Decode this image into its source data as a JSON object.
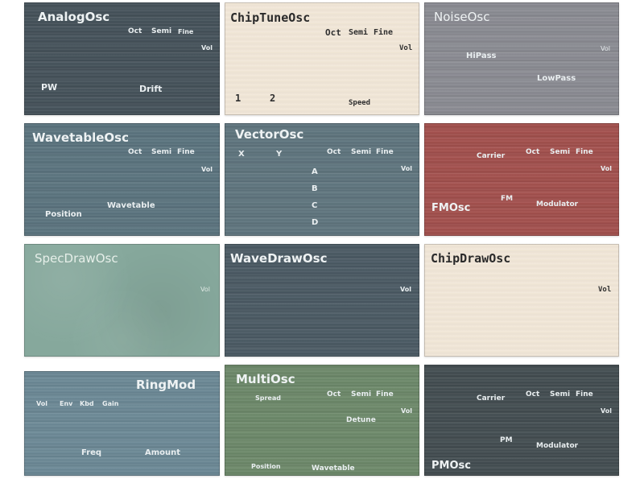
{
  "colors": {
    "analog_bg": "#46535b",
    "chiptune_bg": "#f1e6d7",
    "noise_bg": "#8c8d94",
    "wavetable_bg": "#5c7580",
    "vector_bg": "#60767f",
    "fm_bg": "#a4514e",
    "specdraw_bg": "#86a89c",
    "wavedraw_bg": "#4c5b65",
    "chipdraw_bg": "#f1e6d7",
    "ringmod_bg": "#6d8a97",
    "multi_bg": "#6e8a6b",
    "pm_bg": "#444e52"
  },
  "panels": {
    "analog": {
      "title": "AnalogOsc",
      "oct": "Oct",
      "semi": "Semi",
      "fine": "Fine",
      "vol": "Vol",
      "pw": "PW",
      "drift": "Drift"
    },
    "chiptune": {
      "title": "ChipTuneOsc",
      "oct": "Oct",
      "semi": "Semi",
      "fine": "Fine",
      "vol": "Vol",
      "one": "1",
      "two": "2",
      "speed": "Speed"
    },
    "noise": {
      "title": "NoiseOsc",
      "vol": "Vol",
      "hipass": "HiPass",
      "lowpass": "LowPass"
    },
    "wavetable": {
      "title": "WavetableOsc",
      "oct": "Oct",
      "semi": "Semi",
      "fine": "Fine",
      "vol": "Vol",
      "position": "Position",
      "wavetable": "Wavetable"
    },
    "vector": {
      "title": "VectorOsc",
      "x": "X",
      "y": "Y",
      "oct": "Oct",
      "semi": "Semi",
      "fine": "Fine",
      "vol": "Vol",
      "a": "A",
      "b": "B",
      "c": "C",
      "d": "D"
    },
    "fm": {
      "title": "FMOsc",
      "carrier": "Carrier",
      "oct": "Oct",
      "semi": "Semi",
      "fine": "Fine",
      "vol": "Vol",
      "fm": "FM",
      "modulator": "Modulator"
    },
    "specdraw": {
      "title": "SpecDrawOsc",
      "vol": "Vol"
    },
    "wavedraw": {
      "title": "WaveDrawOsc",
      "vol": "Vol"
    },
    "chipdraw": {
      "title": "ChipDrawOsc",
      "vol": "Vol"
    },
    "ringmod": {
      "title": "RingMod",
      "vol": "Vol",
      "env": "Env",
      "kbd": "Kbd",
      "gain": "Gain",
      "freq": "Freq",
      "amount": "Amount"
    },
    "multi": {
      "title": "MultiOsc",
      "spread": "Spread",
      "oct": "Oct",
      "semi": "Semi",
      "fine": "Fine",
      "vol": "Vol",
      "detune": "Detune",
      "position": "Position",
      "wavetable": "Wavetable"
    },
    "pm": {
      "title": "PMOsc",
      "carrier": "Carrier",
      "oct": "Oct",
      "semi": "Semi",
      "fine": "Fine",
      "vol": "Vol",
      "pm": "PM",
      "modulator": "Modulator"
    }
  }
}
